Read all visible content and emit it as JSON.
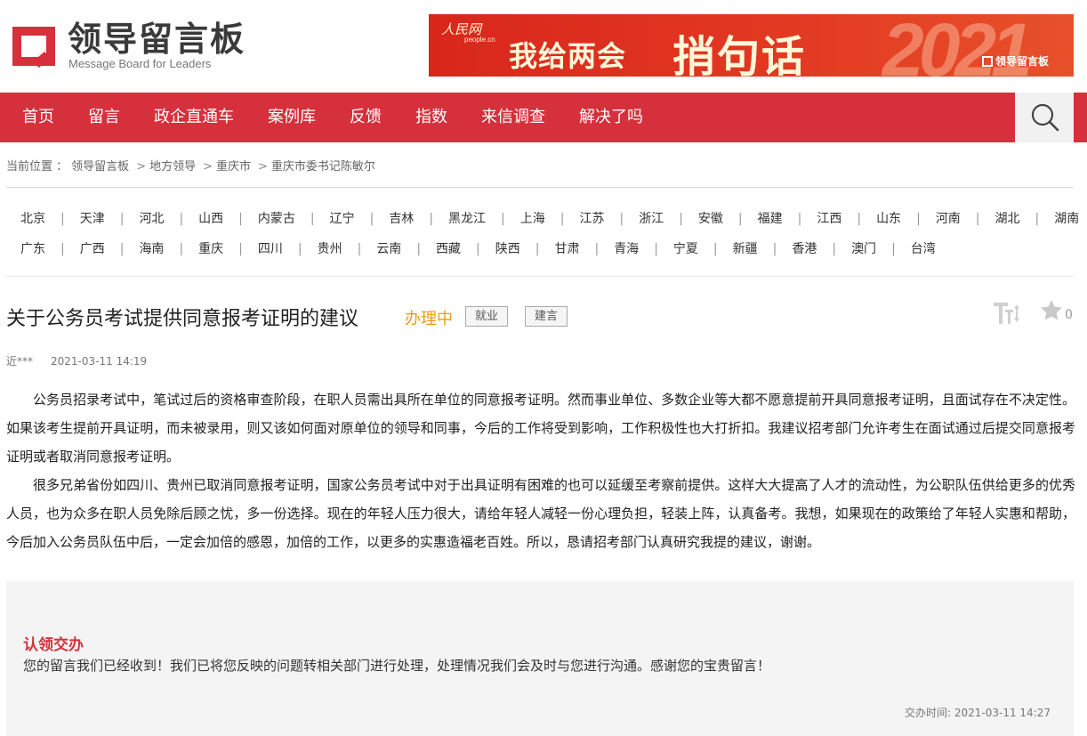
{
  "header": {
    "logo_cn": "领导留言板",
    "logo_en": "Message Board for Leaders"
  },
  "banner": {
    "site_name": "人民网",
    "site_domain": "people.cn",
    "main_text": "我给两会",
    "main_big": "捎句话",
    "year": "2021",
    "tag": "领导留言板"
  },
  "nav": {
    "items": [
      "首页",
      "留言",
      "政企直通车",
      "案例库",
      "反馈",
      "指数",
      "来信调查",
      "解决了吗"
    ],
    "search_icon": "search-icon"
  },
  "breadcrumb": {
    "prefix": "当前位置 ：",
    "items": [
      "领导留言板",
      "地方领导",
      "重庆市",
      "重庆市委书记陈敏尔"
    ],
    "separator": ">"
  },
  "provinces": {
    "row1": [
      "北京",
      "天津",
      "河北",
      "山西",
      "内蒙古",
      "辽宁",
      "吉林",
      "黑龙江",
      "上海",
      "江苏",
      "浙江",
      "安徽",
      "福建",
      "江西",
      "山东",
      "河南",
      "湖北",
      "湖南"
    ],
    "row2": [
      "广东",
      "广西",
      "海南",
      "重庆",
      "四川",
      "贵州",
      "云南",
      "西藏",
      "陕西",
      "甘肃",
      "青海",
      "宁夏",
      "新疆",
      "香港",
      "澳门",
      "台湾"
    ],
    "separator": "|"
  },
  "post": {
    "title": "关于公务员考试提供同意报考证明的建议",
    "status": "办理中",
    "tags": [
      "就业",
      "建言"
    ],
    "favorite_count": "0",
    "author": "近***",
    "time": "2021-03-11 14:19",
    "paragraphs": [
      "公务员招录考试中，笔试过后的资格审查阶段，在职人员需出具所在单位的同意报考证明。然而事业单位、多数企业等大都不愿意提前开具同意报考证明，且面试存在不决定性。如果该考生提前开具证明，而未被录用，则又该如何面对原单位的领导和同事，今后的工作将受到影响，工作积极性也大打折扣。我建议招考部门允许考生在面试通过后提交同意报考证明或者取消同意报考证明。",
      "很多兄弟省份如四川、贵州已取消同意报考证明，国家公务员考试中对于出具证明有困难的也可以延缓至考察前提供。这样大大提高了人才的流动性，为公职队伍供给更多的优秀人员，也为众多在职人员免除后顾之忧，多一份选择。现在的年轻人压力很大，请给年轻人减轻一份心理负担，轻装上阵，认真备考。我想，如果现在的政策给了年轻人实惠和帮助，今后加入公务员队伍中后，一定会加倍的感恩，加倍的工作，以更多的实惠造福老百姓。所以，恳请招考部门认真研究我提的建议，谢谢。"
    ]
  },
  "reply": {
    "title": "认领交办",
    "text": "您的留言我们已经收到！我们已将您反映的问题转相关部门进行处理，处理情况我们会及时与您进行沟通。感谢您的宝贵留言！",
    "time": "交办时间: 2021-03-11 14:27"
  },
  "colors": {
    "brand_red": "#d5303c",
    "status_orange": "#f09a16"
  }
}
